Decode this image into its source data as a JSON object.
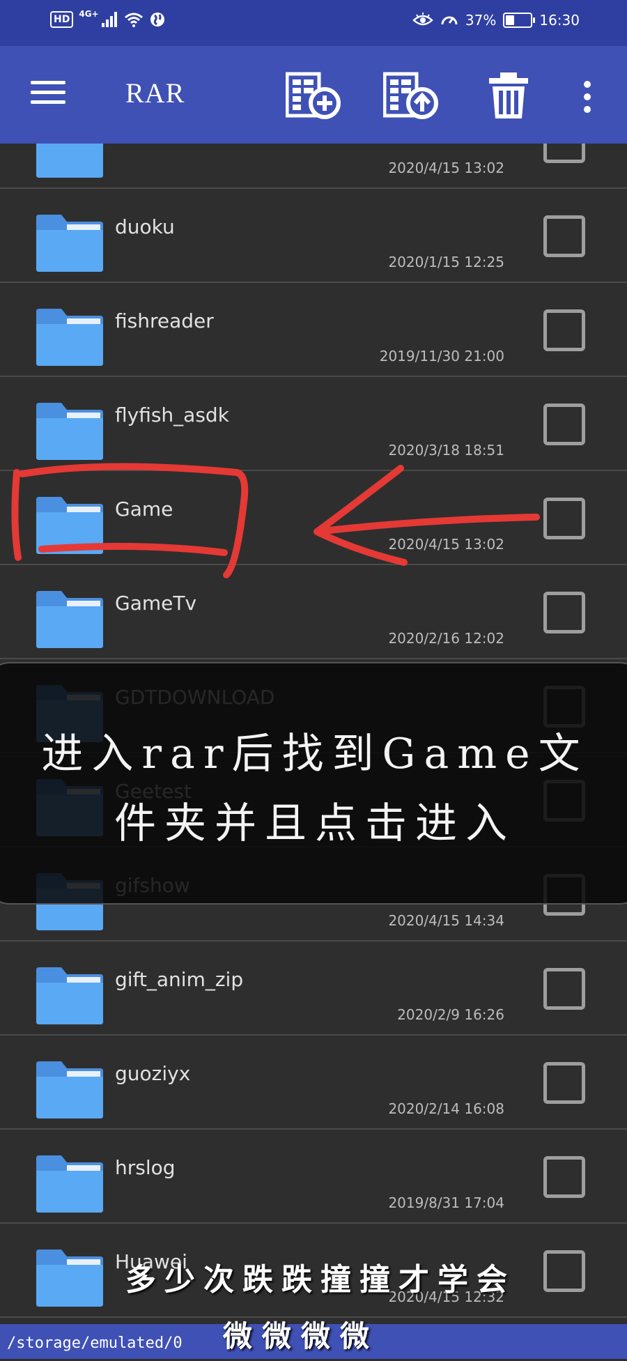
{
  "status_bar": {
    "hd": "HD",
    "network": "4G+",
    "battery_text": "37%",
    "battery_level": 0.37,
    "time": "16:30"
  },
  "app_bar": {
    "title": "RAR",
    "icons": [
      "menu-icon",
      "archive-add-icon",
      "archive-extract-icon",
      "trash-icon",
      "more-vert-icon"
    ]
  },
  "files": [
    {
      "name": "",
      "date": "2020/4/15 13:02"
    },
    {
      "name": "duoku",
      "date": "2020/1/15 12:25"
    },
    {
      "name": "fishreader",
      "date": "2019/11/30 21:00"
    },
    {
      "name": "flyfish_asdk",
      "date": "2020/3/18 18:51"
    },
    {
      "name": "Game",
      "date": "2020/4/15 13:02"
    },
    {
      "name": "GameTv",
      "date": "2020/2/16 12:02"
    },
    {
      "name": "GDTDOWNLOAD",
      "date": ""
    },
    {
      "name": "Geetest",
      "date": ""
    },
    {
      "name": "gifshow",
      "date": "2020/4/15 14:34"
    },
    {
      "name": "gift_anim_zip",
      "date": "2020/2/9 16:26"
    },
    {
      "name": "guoziyx",
      "date": "2020/2/14 16:08"
    },
    {
      "name": "hrslog",
      "date": "2019/8/31 17:04"
    },
    {
      "name": "Huawei",
      "date": "2020/4/15 12:32"
    }
  ],
  "instruction_overlay": {
    "text": "进入rar后找到Game文\n件夹并且点击进入"
  },
  "watermark": {
    "line1": "多少次跌跌撞撞才学会",
    "line2": "微微微微"
  },
  "path_bar": {
    "path": "/storage/emulated/0"
  },
  "colors": {
    "app_bar": "#3f51b5",
    "status_bar": "#2f3fa1",
    "background": "#2e2e2e",
    "folder": "#5aa9f5",
    "annotation": "#e53935"
  }
}
